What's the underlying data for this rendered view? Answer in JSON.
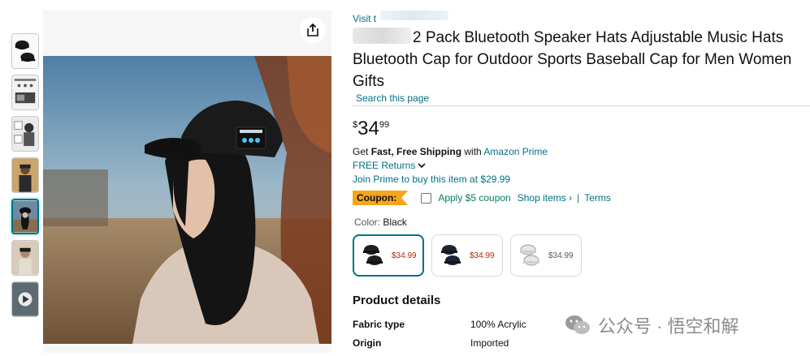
{
  "store": {
    "link_text": "Visit t"
  },
  "product": {
    "title": "2 Pack Bluetooth Speaker Hats Adjustable Music Hats Bluetooth Cap for Outdoor Sports Baseball Cap for Men Women Gifts",
    "search_link": "Search this page"
  },
  "price": {
    "symbol": "$",
    "whole": "34",
    "fraction": "99"
  },
  "shipping": {
    "prefix": "Get ",
    "bold": "Fast, Free Shipping",
    "mid": " with ",
    "link": "Amazon Prime"
  },
  "returns": {
    "label": "FREE Returns"
  },
  "prime": {
    "join_text": "Join Prime to buy this item at $29.99"
  },
  "coupon": {
    "badge": "Coupon:",
    "apply": "Apply $5 coupon",
    "shop": "Shop items ›",
    "separator": "|",
    "terms": "Terms"
  },
  "color": {
    "label": "Color: ",
    "value": "Black"
  },
  "variants": [
    {
      "price": "$34.99",
      "selected": true,
      "cap_color": "#1e1e1e"
    },
    {
      "price": "$34.99",
      "selected": false,
      "cap_color": "#1c2331"
    },
    {
      "price": "$34.99",
      "selected": false,
      "cap_color": "#e6e6e6"
    }
  ],
  "details": {
    "title": "Product details",
    "rows": [
      {
        "key": "Fabric type",
        "value": "100% Acrylic"
      },
      {
        "key": "Origin",
        "value": "Imported"
      }
    ]
  },
  "watermark": {
    "text": "公众号 · 悟空和解"
  },
  "icons": {
    "share": "share-icon",
    "chevron": "chevron-down-icon",
    "wechat": "wechat-icon"
  },
  "colors": {
    "link": "#007185",
    "coupon_badge": "#f7a51c",
    "coupon_green": "#067d62",
    "price_red": "#b12704"
  }
}
